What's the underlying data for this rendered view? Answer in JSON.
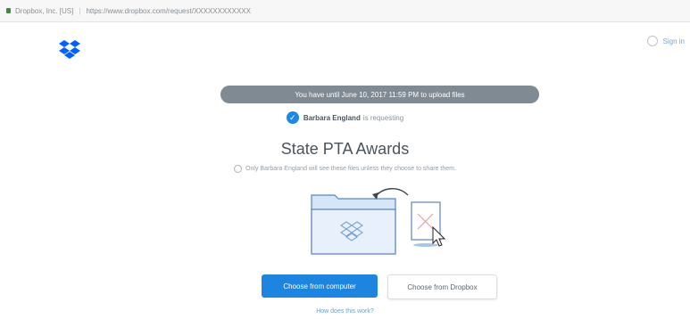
{
  "browser": {
    "site": "Dropbox, Inc. [US]",
    "separator": "|",
    "url": "https://www.dropbox.com/request/XXXXXXXXXXXX"
  },
  "header": {
    "signin": "Sign in"
  },
  "banner": "You have until June 10, 2017 11:59 PM to upload files",
  "requester": {
    "name": "Barbara England",
    "rest": "is requesting"
  },
  "request": {
    "title": "State PTA Awards",
    "note": "Only Barbara England will see these files unless they choose to share them."
  },
  "actions": {
    "primary": "Choose from computer",
    "secondary": "Choose from Dropbox",
    "link": "How does this work?"
  },
  "colors": {
    "accent": "#1d85e0",
    "banner": "#7f8a93"
  }
}
